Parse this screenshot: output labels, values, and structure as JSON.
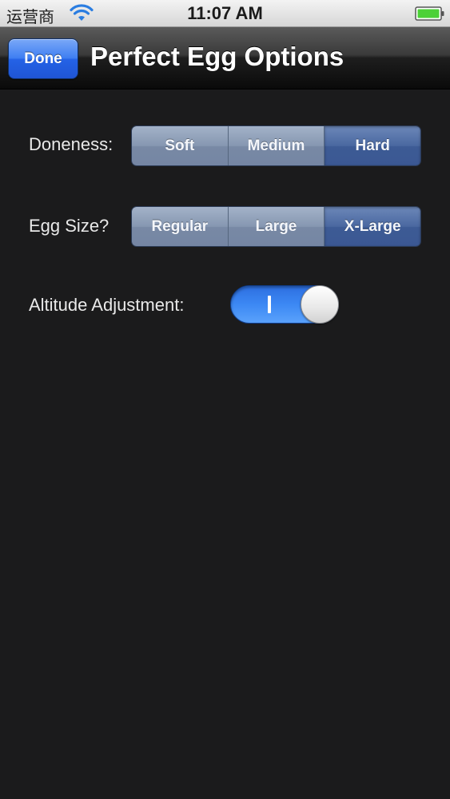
{
  "status_bar": {
    "carrier": "运营商",
    "time": "11:07 AM",
    "icons": [
      "wifi-icon",
      "battery-icon"
    ]
  },
  "nav_bar": {
    "done_label": "Done",
    "title": "Perfect Egg Options"
  },
  "doneness": {
    "label": "Doneness:",
    "options": [
      "Soft",
      "Medium",
      "Hard"
    ],
    "selected": "Hard"
  },
  "egg_size": {
    "label": "Egg Size?",
    "options": [
      "Regular",
      "Large",
      "X-Large"
    ],
    "selected": "X-Large"
  },
  "altitude": {
    "label": "Altitude Adjustment:",
    "on": true
  },
  "colors": {
    "background": "#1b1b1c",
    "done_blue": "#2462e6",
    "segment_selected": "#3d5b95",
    "segment_normal": "#8697b1",
    "switch_on": "#3c88f4",
    "battery_green": "#4cd137"
  }
}
